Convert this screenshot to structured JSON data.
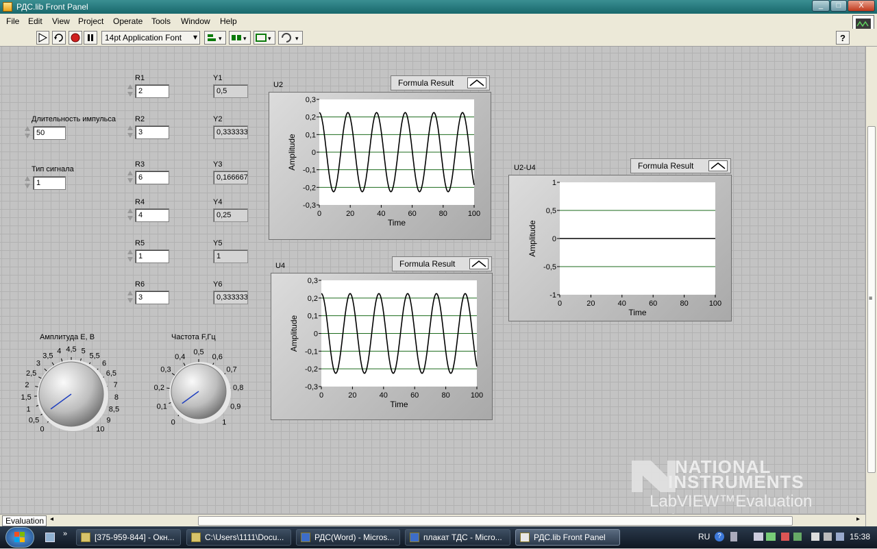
{
  "window": {
    "title": "РДС.lib Front Panel",
    "controls": {
      "minimize": "_",
      "maximize": "□",
      "close": "X"
    }
  },
  "menu": [
    "File",
    "Edit",
    "View",
    "Project",
    "Operate",
    "Tools",
    "Window",
    "Help"
  ],
  "toolbar": {
    "font_select": "14pt Application Font",
    "icons": [
      "run-arrow-icon",
      "run-continuous-icon",
      "abort-icon",
      "pause-icon",
      "align-icon",
      "distribute-icon",
      "resize-icon",
      "reorder-icon",
      "help-icon"
    ]
  },
  "controls": {
    "duration": {
      "label": "Длительность импульса",
      "value": "50"
    },
    "signal_type": {
      "label": "Тип сигнала",
      "value": "1"
    },
    "resistors": [
      {
        "label": "R1",
        "value": "2"
      },
      {
        "label": "R2",
        "value": "3"
      },
      {
        "label": "R3",
        "value": "6"
      },
      {
        "label": "R4",
        "value": "4"
      },
      {
        "label": "R5",
        "value": "1"
      },
      {
        "label": "R6",
        "value": "3"
      }
    ],
    "outputs": [
      {
        "label": "Y1",
        "value": "0,5"
      },
      {
        "label": "Y2",
        "value": "0,333333"
      },
      {
        "label": "Y3",
        "value": "0,166667"
      },
      {
        "label": "Y4",
        "value": "0,25"
      },
      {
        "label": "Y5",
        "value": "1"
      },
      {
        "label": "Y6",
        "value": "0,333333"
      }
    ],
    "amplitude_knob": {
      "label": "Амплитуда E, В",
      "ticks": [
        "0",
        "0,5",
        "1",
        "1,5",
        "2",
        "2,5",
        "3",
        "3,5",
        "4",
        "4,5",
        "5",
        "5,5",
        "6",
        "6,5",
        "7",
        "8",
        "8,5",
        "9",
        "10"
      ],
      "value_fraction": 0.05
    },
    "frequency_knob": {
      "label": "Частота F,Гц",
      "ticks": [
        "0",
        "0,1",
        "0,2",
        "0,3",
        "0,4",
        "0,5",
        "0,6",
        "0,7",
        "0,8",
        "0,9",
        "1"
      ],
      "value_fraction": 0.05
    }
  },
  "graphs": {
    "u2": {
      "label": "U2",
      "legend": "Formula Result",
      "xlabel": "Time",
      "ylabel": "Amplitude",
      "yticks": [
        "0,3",
        "0,2",
        "0,1",
        "0",
        "-0,1",
        "-0,2",
        "-0,3"
      ],
      "xticks": [
        "0",
        "20",
        "40",
        "60",
        "80",
        "100"
      ]
    },
    "u4": {
      "label": "U4",
      "legend": "Formula Result",
      "xlabel": "Time",
      "ylabel": "Amplitude",
      "yticks": [
        "0,3",
        "0,2",
        "0,1",
        "0",
        "-0,1",
        "-0,2",
        "-0,3"
      ],
      "xticks": [
        "0",
        "20",
        "40",
        "60",
        "80",
        "100"
      ]
    },
    "u2u4": {
      "label": "U2-U4",
      "legend": "Formula Result",
      "xlabel": "Time",
      "ylabel": "Amplitude",
      "yticks": [
        "1",
        "0,5",
        "0",
        "-0,5",
        "-1"
      ],
      "xticks": [
        "0",
        "20",
        "40",
        "60",
        "80",
        "100"
      ]
    }
  },
  "chart_data": [
    {
      "type": "line",
      "title": "U2",
      "xlabel": "Time",
      "ylabel": "Amplitude",
      "xlim": [
        0,
        100
      ],
      "ylim": [
        -0.3,
        0.3
      ],
      "grid": true,
      "legend": "top-right",
      "series": [
        {
          "name": "Formula Result",
          "function": "0.225*cos(2*pi*x/18.5)",
          "amplitude": 0.225,
          "period": 18.5
        }
      ]
    },
    {
      "type": "line",
      "title": "U4",
      "xlabel": "Time",
      "ylabel": "Amplitude",
      "xlim": [
        0,
        100
      ],
      "ylim": [
        -0.3,
        0.3
      ],
      "grid": true,
      "legend": "top-right",
      "series": [
        {
          "name": "Formula Result",
          "function": "0.225*cos(2*pi*x/18.5)",
          "amplitude": 0.225,
          "period": 18.5
        }
      ]
    },
    {
      "type": "line",
      "title": "U2-U4",
      "xlabel": "Time",
      "ylabel": "Amplitude",
      "xlim": [
        0,
        100
      ],
      "ylim": [
        -1,
        1
      ],
      "grid": true,
      "legend": "top-right",
      "series": [
        {
          "name": "Formula Result",
          "x": [
            0,
            100
          ],
          "y": [
            0,
            0
          ]
        }
      ]
    }
  ],
  "watermark": {
    "line1": "NATIONAL",
    "line2": "INSTRUMENTS",
    "line3": "LabVIEW™Evaluation Software"
  },
  "status": {
    "evaluation": "Evaluation"
  },
  "taskbar": {
    "tasks": [
      "[375-959-844] - Окн...",
      "C:\\Users\\1111\\Docu...",
      "РДС(Word) - Micros...",
      "плакат ТДС - Micro...",
      "РДС.lib Front Panel"
    ],
    "lang": "RU",
    "clock": "15:38"
  },
  "colors": {
    "plot_grid": "#1a6a1a",
    "plot_line": "#000000",
    "knob_needle": "#1f3fbf",
    "title_bar": "#247a7e"
  }
}
